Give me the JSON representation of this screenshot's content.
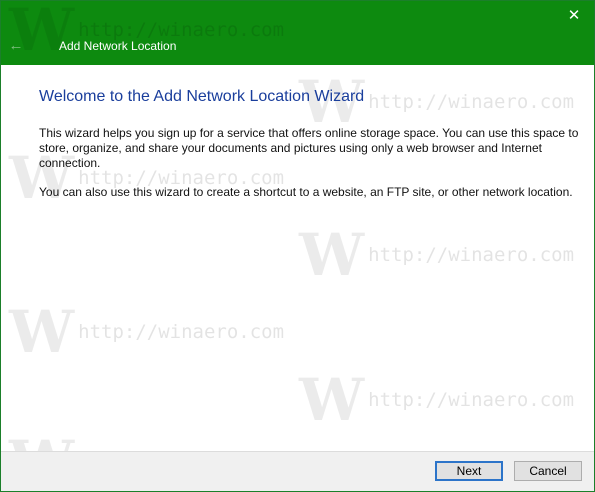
{
  "window": {
    "title": "Add Network Location",
    "back_icon": "←",
    "close_icon": "✕"
  },
  "content": {
    "heading": "Welcome to the Add Network Location Wizard",
    "paragraph1": "This wizard helps you sign up for a service that offers online storage space.  You can use this space to store, organize, and share your documents and pictures using only a web browser and Internet connection.",
    "paragraph2": "You can also use this wizard to create a shortcut to a website, an FTP site, or other network location."
  },
  "footer": {
    "next_label": "Next",
    "cancel_label": "Cancel"
  },
  "watermark": {
    "logo_letter": "W",
    "url": "http://winaero.com"
  },
  "colors": {
    "titlebar": "#0d8a0f",
    "heading": "#1a3e9c"
  }
}
